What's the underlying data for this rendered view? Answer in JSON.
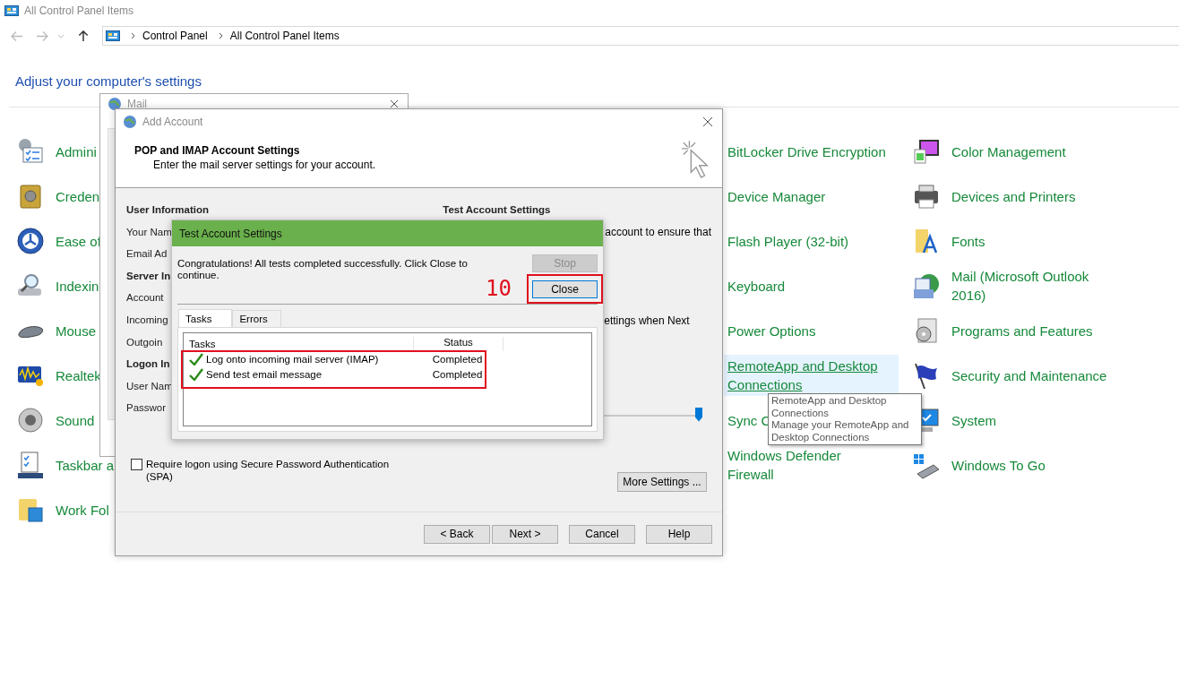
{
  "window": {
    "title": "All Control Panel Items"
  },
  "address_bar": {
    "breadcrumbs": [
      "Control Panel",
      "All Control Panel Items"
    ]
  },
  "heading": "Adjust your computer's settings",
  "items_column_1": [
    {
      "label": "Admini"
    },
    {
      "label": "Creden"
    },
    {
      "label": "Ease of"
    },
    {
      "label": "Indexin"
    },
    {
      "label": "Mouse"
    },
    {
      "label": "Realtek"
    },
    {
      "label": "Sound"
    },
    {
      "label": "Taskbar a"
    },
    {
      "label": "Work Fol"
    }
  ],
  "items_column_2": [
    {
      "label": "BitLocker Drive Encryption",
      "hovered": false
    },
    {
      "label": "Device Manager",
      "hovered": false
    },
    {
      "label": "Flash Player (32-bit)",
      "hovered": false
    },
    {
      "label": "Keyboard",
      "hovered": false
    },
    {
      "label": "Power Options",
      "hovered": false
    },
    {
      "label": "RemoteApp and Desktop Connections",
      "hovered": true
    },
    {
      "label": "Sync C",
      "hovered": false
    },
    {
      "label": "Windows Defender Firewall",
      "hovered": false
    }
  ],
  "items_column_3": [
    {
      "label": "Color Management"
    },
    {
      "label": "Devices and Printers"
    },
    {
      "label": "Fonts"
    },
    {
      "label": "Mail (Microsoft Outlook 2016)"
    },
    {
      "label": "Programs and Features"
    },
    {
      "label": "Security and Maintenance"
    },
    {
      "label": "System"
    },
    {
      "label": "Windows To Go"
    }
  ],
  "tooltip": {
    "title": "RemoteApp and Desktop Connections",
    "description": "Manage your RemoteApp and Desktop Connections"
  },
  "mail_window": {
    "title": "Mail"
  },
  "add_account": {
    "title": "Add Account",
    "header_title": "POP and IMAP Account Settings",
    "header_subtitle": "Enter the mail server settings for your account.",
    "left_fields": [
      {
        "kind": "heading",
        "text": "User Information"
      },
      {
        "kind": "label",
        "text": "Your Nam"
      },
      {
        "kind": "label",
        "text": "Email Ad"
      },
      {
        "kind": "heading",
        "text": "Server In"
      },
      {
        "kind": "label",
        "text": "Account"
      },
      {
        "kind": "label",
        "text": "Incoming"
      },
      {
        "kind": "label",
        "text": "Outgoin"
      },
      {
        "kind": "heading",
        "text": "Logon In"
      },
      {
        "kind": "label",
        "text": "User Nam"
      },
      {
        "kind": "label",
        "text": "Passwor"
      }
    ],
    "right_heading": "Test Account Settings",
    "right_text_1": "account to ensure that",
    "right_text_2": "ettings when Next",
    "slider": {
      "level": 1
    },
    "spa_checkbox": {
      "label": "Require logon using Secure Password Authentication (SPA)",
      "checked": false
    },
    "more_settings_button": "More Settings ...",
    "buttons": [
      "< Back",
      "Next >",
      "Cancel",
      "Help"
    ]
  },
  "test_dialog": {
    "title": "Test Account Settings",
    "message": "Congratulations! All tests completed successfully. Click Close to continue.",
    "buttons": [
      {
        "label": "Stop",
        "disabled": true
      },
      {
        "label": "Close",
        "disabled": false
      }
    ],
    "step_number": "10",
    "tabs": [
      {
        "label": "Tasks",
        "selected": true
      },
      {
        "label": "Errors",
        "selected": false
      }
    ],
    "columns": [
      "Tasks",
      "Status"
    ],
    "rows": [
      {
        "task": "Log onto incoming mail server (IMAP)",
        "status": "Completed",
        "done": true
      },
      {
        "task": "Send test email message",
        "status": "Completed",
        "done": true
      }
    ]
  }
}
